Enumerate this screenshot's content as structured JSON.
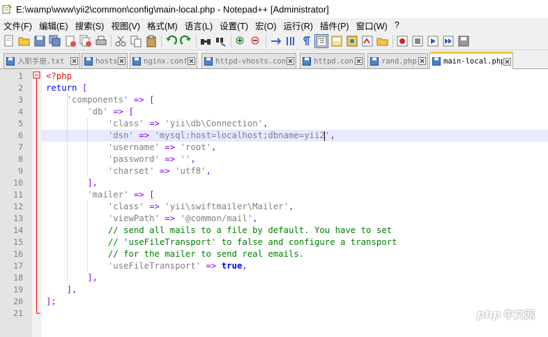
{
  "window": {
    "title": "E:\\wamp\\www\\yii2\\common\\config\\main-local.php - Notepad++ [Administrator]"
  },
  "menu": [
    "文件(F)",
    "编辑(E)",
    "搜索(S)",
    "视图(V)",
    "格式(M)",
    "语言(L)",
    "设置(T)",
    "宏(O)",
    "运行(R)",
    "插件(P)",
    "窗口(W)",
    "?"
  ],
  "toolbar": {
    "buttons": [
      "new-file-icon",
      "open-file-icon",
      "save-icon",
      "save-all-icon",
      "close-icon",
      "close-all-icon",
      "print-icon",
      "cut-icon",
      "copy-icon",
      "paste-icon",
      "undo-icon",
      "redo-icon",
      "find-icon",
      "replace-icon",
      "zoom-in-icon",
      "zoom-out-icon",
      "sync-scroll-icon",
      "wrap-icon",
      "show-all-chars-icon",
      "indent-guide-icon",
      "doc-map-icon",
      "function-list-icon",
      "folder-icon",
      "pdf-icon",
      "record-macro-icon",
      "stop-record-icon",
      "play-macro-icon",
      "run-macro-multiple-icon",
      "save-macro-icon"
    ],
    "active": "indent-guide-icon"
  },
  "tabs": [
    {
      "label": "入职手册.txt",
      "active": false
    },
    {
      "label": "hosts",
      "active": false
    },
    {
      "label": "nginx.conf",
      "active": false
    },
    {
      "label": "httpd-vhosts.conf",
      "active": false
    },
    {
      "label": "httpd.conf",
      "active": false
    },
    {
      "label": "rand.php",
      "active": false
    },
    {
      "label": "main-local.php",
      "active": true
    }
  ],
  "editor": {
    "current_line": 6,
    "lines": [
      {
        "n": "1",
        "tokens": [
          [
            "php",
            "<?php"
          ]
        ]
      },
      {
        "n": "2",
        "tokens": [
          [
            "word",
            "return"
          ],
          [
            "plain",
            " "
          ],
          [
            "op",
            "["
          ]
        ]
      },
      {
        "n": "3",
        "tokens": [
          [
            "plain",
            "    "
          ],
          [
            "str",
            "'components'"
          ],
          [
            "plain",
            " "
          ],
          [
            "op",
            "=>"
          ],
          [
            "plain",
            " "
          ],
          [
            "op",
            "["
          ]
        ]
      },
      {
        "n": "4",
        "tokens": [
          [
            "plain",
            "        "
          ],
          [
            "str",
            "'db'"
          ],
          [
            "plain",
            " "
          ],
          [
            "op",
            "=>"
          ],
          [
            "plain",
            " "
          ],
          [
            "op",
            "["
          ]
        ]
      },
      {
        "n": "5",
        "tokens": [
          [
            "plain",
            "            "
          ],
          [
            "str",
            "'class'"
          ],
          [
            "plain",
            " "
          ],
          [
            "op",
            "=>"
          ],
          [
            "plain",
            " "
          ],
          [
            "str",
            "'yii\\db\\Connection'"
          ],
          [
            "op",
            ","
          ]
        ]
      },
      {
        "n": "6",
        "tokens": [
          [
            "plain",
            "            "
          ],
          [
            "str",
            "'dsn'"
          ],
          [
            "plain",
            " "
          ],
          [
            "op",
            "=>"
          ],
          [
            "plain",
            " "
          ],
          [
            "str",
            "'mysql:host=localhost;dbname=yii2"
          ],
          [
            "caret",
            ""
          ],
          [
            "str",
            "'"
          ],
          [
            "op",
            ","
          ]
        ]
      },
      {
        "n": "7",
        "tokens": [
          [
            "plain",
            "            "
          ],
          [
            "str",
            "'username'"
          ],
          [
            "plain",
            " "
          ],
          [
            "op",
            "=>"
          ],
          [
            "plain",
            " "
          ],
          [
            "str",
            "'root'"
          ],
          [
            "op",
            ","
          ]
        ]
      },
      {
        "n": "8",
        "tokens": [
          [
            "plain",
            "            "
          ],
          [
            "str",
            "'password'"
          ],
          [
            "plain",
            " "
          ],
          [
            "op",
            "=>"
          ],
          [
            "plain",
            " "
          ],
          [
            "str",
            "''"
          ],
          [
            "op",
            ","
          ]
        ]
      },
      {
        "n": "9",
        "tokens": [
          [
            "plain",
            "            "
          ],
          [
            "str",
            "'charset'"
          ],
          [
            "plain",
            " "
          ],
          [
            "op",
            "=>"
          ],
          [
            "plain",
            " "
          ],
          [
            "str",
            "'utf8'"
          ],
          [
            "op",
            ","
          ]
        ]
      },
      {
        "n": "10",
        "tokens": [
          [
            "plain",
            "        "
          ],
          [
            "op",
            "],"
          ]
        ]
      },
      {
        "n": "11",
        "tokens": [
          [
            "plain",
            "        "
          ],
          [
            "str",
            "'mailer'"
          ],
          [
            "plain",
            " "
          ],
          [
            "op",
            "=>"
          ],
          [
            "plain",
            " "
          ],
          [
            "op",
            "["
          ]
        ]
      },
      {
        "n": "12",
        "tokens": [
          [
            "plain",
            "            "
          ],
          [
            "str",
            "'class'"
          ],
          [
            "plain",
            " "
          ],
          [
            "op",
            "=>"
          ],
          [
            "plain",
            " "
          ],
          [
            "str",
            "'yii\\swiftmailer\\Mailer'"
          ],
          [
            "op",
            ","
          ]
        ]
      },
      {
        "n": "13",
        "tokens": [
          [
            "plain",
            "            "
          ],
          [
            "str",
            "'viewPath'"
          ],
          [
            "plain",
            " "
          ],
          [
            "op",
            "=>"
          ],
          [
            "plain",
            " "
          ],
          [
            "str",
            "'@common/mail'"
          ],
          [
            "op",
            ","
          ]
        ]
      },
      {
        "n": "14",
        "tokens": [
          [
            "plain",
            "            "
          ],
          [
            "com",
            "// send all mails to a file by default. You have to set"
          ]
        ]
      },
      {
        "n": "15",
        "tokens": [
          [
            "plain",
            "            "
          ],
          [
            "com",
            "// 'useFileTransport' to false and configure a transport"
          ]
        ]
      },
      {
        "n": "16",
        "tokens": [
          [
            "plain",
            "            "
          ],
          [
            "com",
            "// for the mailer to send real emails."
          ]
        ]
      },
      {
        "n": "17",
        "tokens": [
          [
            "plain",
            "            "
          ],
          [
            "str",
            "'useFileTransport'"
          ],
          [
            "plain",
            " "
          ],
          [
            "op",
            "=>"
          ],
          [
            "plain",
            " "
          ],
          [
            "bold",
            "true"
          ],
          [
            "op",
            ","
          ]
        ]
      },
      {
        "n": "18",
        "tokens": [
          [
            "plain",
            "        "
          ],
          [
            "op",
            "],"
          ]
        ]
      },
      {
        "n": "19",
        "tokens": [
          [
            "plain",
            "    "
          ],
          [
            "op",
            "],"
          ]
        ]
      },
      {
        "n": "20",
        "tokens": [
          [
            "op",
            "];"
          ]
        ]
      },
      {
        "n": "21",
        "tokens": []
      }
    ]
  },
  "watermark": {
    "text": "中文网",
    "logo": "php"
  }
}
